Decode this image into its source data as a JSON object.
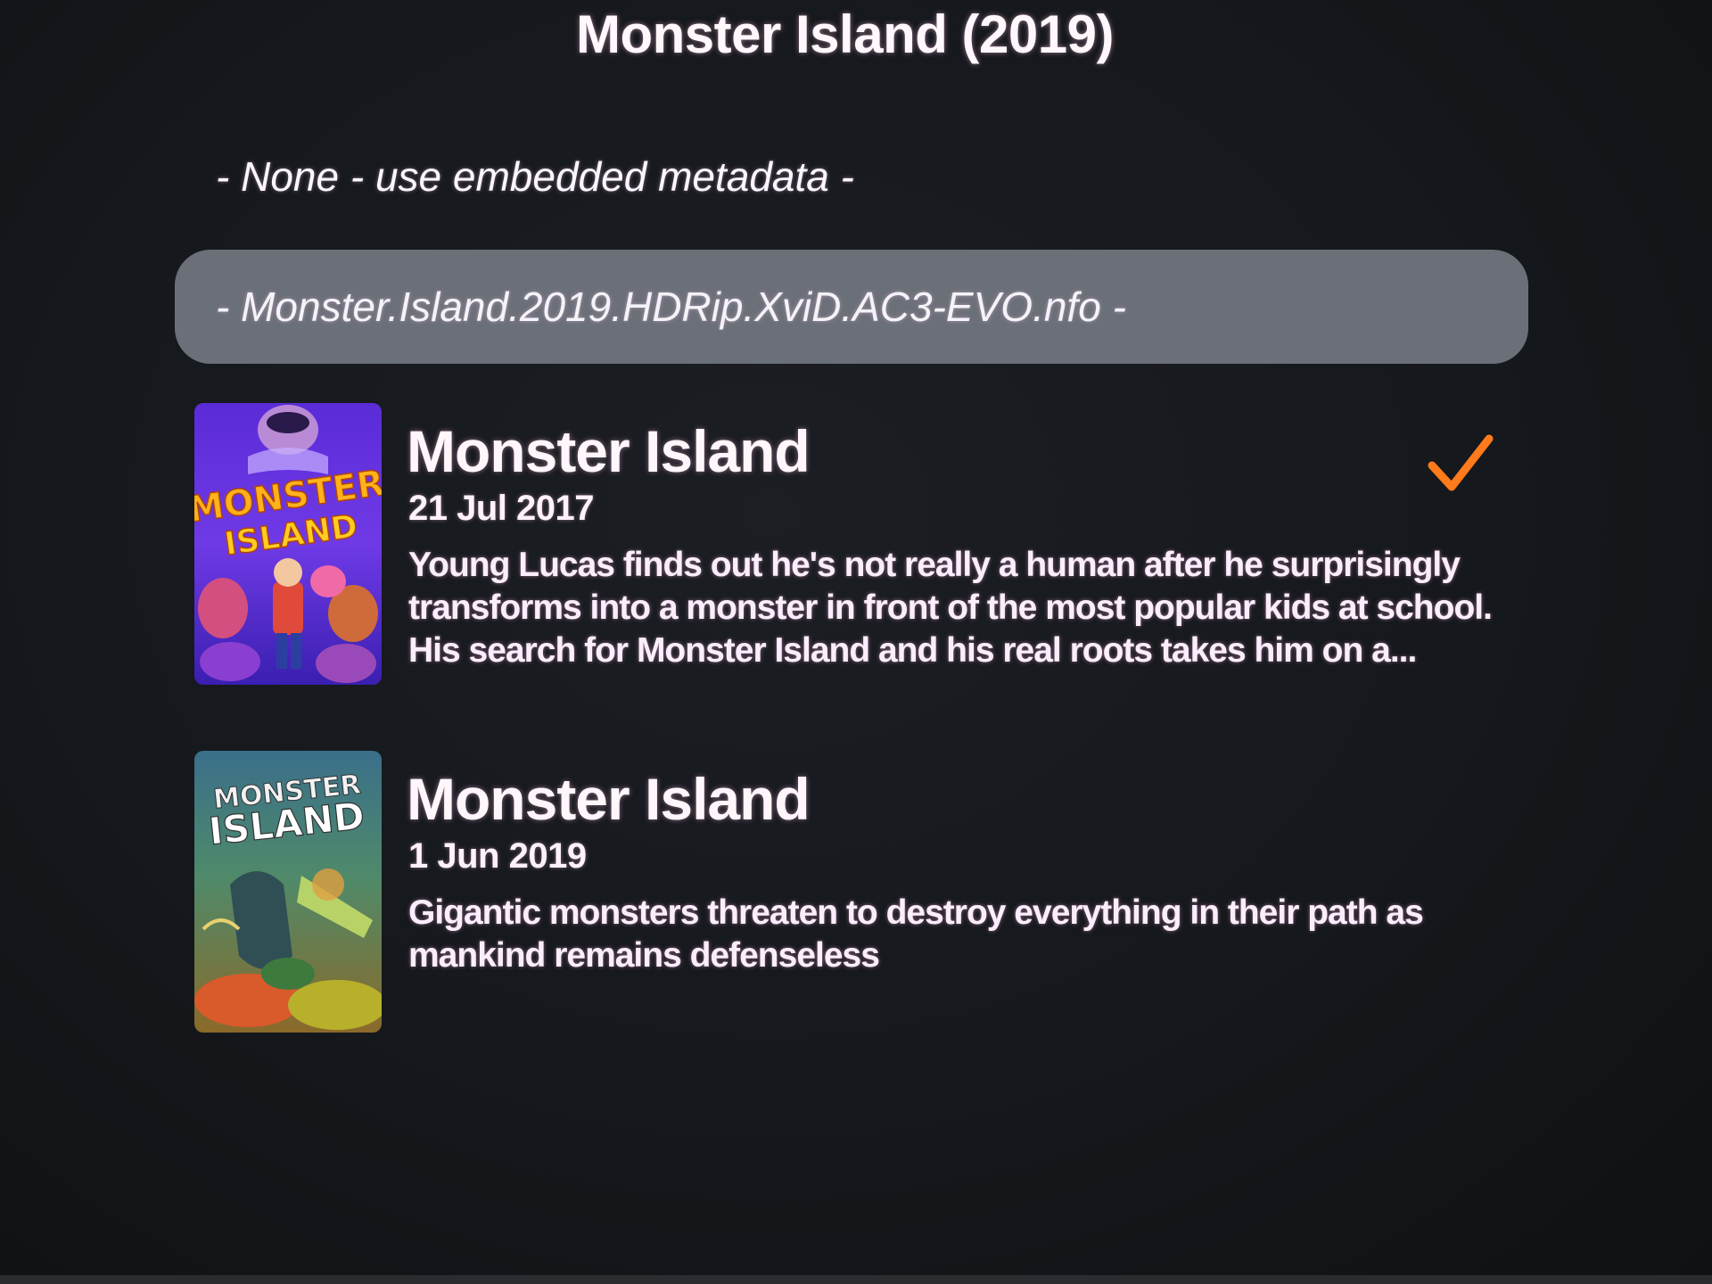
{
  "header": {
    "title": "Monster Island (2019)"
  },
  "options": {
    "none_label": "- None - use embedded metadata -",
    "nfo_label": "- Monster.Island.2019.HDRip.XviD.AC3-EVO.nfo -"
  },
  "results": [
    {
      "title": "Monster Island",
      "date": "21 Jul 2017",
      "description": "Young Lucas finds out he's not really a human after he surprisingly transforms into a monster in front of the most popular kids at school. His search for Monster Island and his real roots takes him on a...",
      "selected": true,
      "poster_icon": "animated-monster-poster"
    },
    {
      "title": "Monster Island",
      "date": "1 Jun 2019",
      "description": "Gigantic monsters threaten to destroy everything in their path as mankind remains defenseless",
      "selected": false,
      "poster_icon": "kaiju-battle-poster"
    }
  ],
  "colors": {
    "background": "#15181c",
    "highlight": "#6a6f78",
    "check": "#ff7a1a",
    "text": "#fff6fb"
  },
  "icons": {
    "selected": "checkmark-icon"
  }
}
